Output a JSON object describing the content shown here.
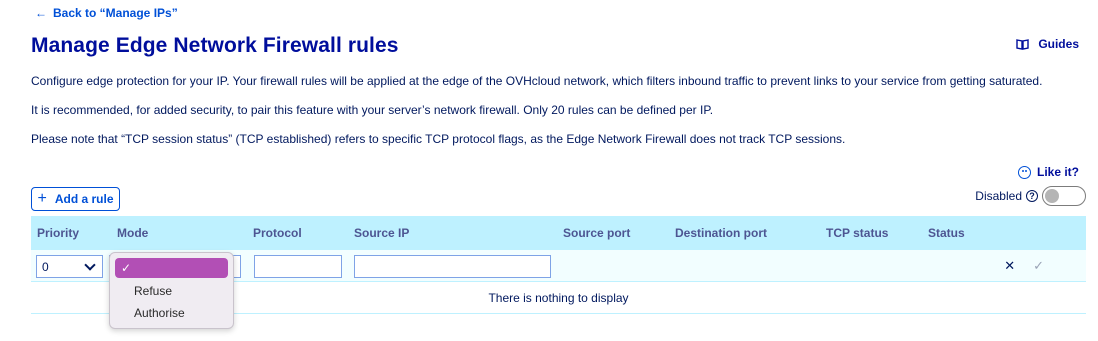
{
  "nav": {
    "back_arrow": "←",
    "back_label": "Back to “Manage IPs”"
  },
  "page": {
    "title": "Manage Edge Network Firewall rules",
    "guides_label": "Guides"
  },
  "description": [
    "Configure edge protection for your IP. Your firewall rules will be applied at the edge of the OVHcloud network, which filters inbound traffic to prevent links to your service from getting saturated.",
    "It is recommended, for added security, to pair this feature with your server’s network firewall. Only 20 rules can be defined per IP.",
    "Please note that “TCP session status” (TCP established) refers to specific TCP protocol flags, as the Edge Network Firewall does not track TCP sessions."
  ],
  "feedback": {
    "label": "Like it?",
    "icon": "smiley-icon"
  },
  "toolbar": {
    "add_rule_icon": "+",
    "add_rule_label": "Add a rule",
    "firewall_state_label": "Disabled",
    "help_icon_glyph": "?",
    "toggle_on": false
  },
  "table": {
    "columns": [
      "Priority",
      "Mode",
      "Protocol",
      "Source IP",
      "Source port",
      "Destination port",
      "TCP status",
      "Status"
    ],
    "edit_row": {
      "priority_value": "0",
      "mode_value": "",
      "protocol_value": "",
      "source_ip_value": "",
      "cancel_glyph": "✕",
      "confirm_glyph": "✓"
    },
    "empty_message": "There is nothing to display"
  },
  "mode_dropdown": {
    "selected_glyph": "✓",
    "options": [
      "Refuse",
      "Authorise"
    ]
  },
  "colors": {
    "link": "#0050d7",
    "title": "#000e9c",
    "table_header_bg": "#bef1ff",
    "dropdown_highlight": "#b24fb5"
  }
}
